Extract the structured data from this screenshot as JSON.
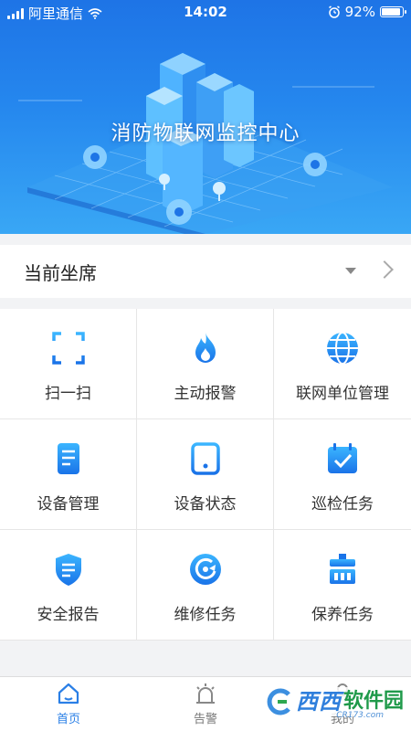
{
  "status_bar": {
    "carrier": "阿里通信",
    "time": "14:02",
    "battery": "92%",
    "battery_level": 0.92
  },
  "banner": {
    "title": "消防物联网监控中心"
  },
  "seat": {
    "label": "当前坐席"
  },
  "grid": {
    "items": [
      {
        "label": "扫一扫",
        "icon": "scan-icon"
      },
      {
        "label": "主动报警",
        "icon": "flame-icon"
      },
      {
        "label": "联网单位管理",
        "icon": "globe-icon"
      },
      {
        "label": "设备管理",
        "icon": "document-icon"
      },
      {
        "label": "设备状态",
        "icon": "device-icon"
      },
      {
        "label": "巡检任务",
        "icon": "calendar-check-icon"
      },
      {
        "label": "安全报告",
        "icon": "shield-report-icon"
      },
      {
        "label": "维修任务",
        "icon": "repair-icon"
      },
      {
        "label": "保养任务",
        "icon": "maintenance-icon"
      }
    ]
  },
  "tabbar": {
    "home": "首页",
    "alarm": "告警",
    "mine": "我的"
  },
  "watermark": {
    "brand": "西西",
    "brand2": "软件园",
    "site": "CR173.com"
  },
  "colors": {
    "accent": "#2a7fe6",
    "icon_blue": "#1f8ff0",
    "banner_top": "#1e74e6"
  }
}
